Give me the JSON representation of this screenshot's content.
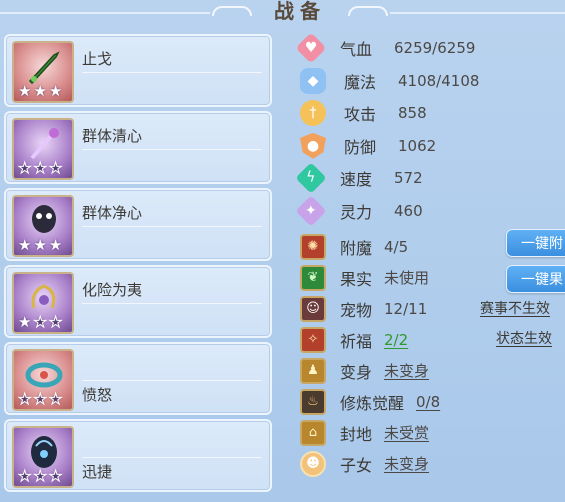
{
  "title": "战备",
  "equipment": [
    {
      "name": "止戈",
      "stars_filled": 3,
      "stars_total": 3,
      "icon": "jade-sword-icon"
    },
    {
      "name": "群体清心",
      "stars_filled": 0,
      "stars_total": 3,
      "icon": "purple-staff-icon"
    },
    {
      "name": "群体净心",
      "stars_filled": 3,
      "stars_total": 3,
      "icon": "demon-mask-icon"
    },
    {
      "name": "化险为夷",
      "stars_filled": 1,
      "stars_total": 3,
      "icon": "golden-chain-icon"
    },
    {
      "name": "愤怒",
      "stars_filled": 0,
      "stars_total": 3,
      "icon": "rage-belt-icon"
    },
    {
      "name": "迅捷",
      "stars_filled": 0,
      "stars_total": 3,
      "icon": "swift-armor-icon"
    }
  ],
  "stats": [
    {
      "label": "气血",
      "value": "6259/6259",
      "icon": "heart-icon"
    },
    {
      "label": "魔法",
      "value": "4108/4108",
      "icon": "mana-icon"
    },
    {
      "label": "攻击",
      "value": "858",
      "icon": "attack-icon"
    },
    {
      "label": "防御",
      "value": "1062",
      "icon": "defense-icon"
    },
    {
      "label": "速度",
      "value": "572",
      "icon": "speed-icon"
    },
    {
      "label": "灵力",
      "value": "460",
      "icon": "spirit-icon"
    }
  ],
  "sub_stats": {
    "enchant": {
      "label": "附魔",
      "value": "4/5"
    },
    "fruit": {
      "label": "果实",
      "value": "未使用"
    },
    "pet": {
      "label": "宠物",
      "value": "12/11"
    },
    "bless": {
      "label": "祈福",
      "value": "2/2"
    },
    "transform": {
      "label": "变身",
      "value": "未变身"
    },
    "cultivate": {
      "label": "修炼觉醒",
      "value": "0/8"
    },
    "fief": {
      "label": "封地",
      "value": "未受赏"
    },
    "child": {
      "label": "子女",
      "value": "未变身"
    }
  },
  "buttons": {
    "one_click_enchant": "一键附",
    "one_click_fruit": "一键果"
  },
  "links": {
    "event_no_effect": "赛事不生效",
    "status_effect": "状态生效"
  }
}
